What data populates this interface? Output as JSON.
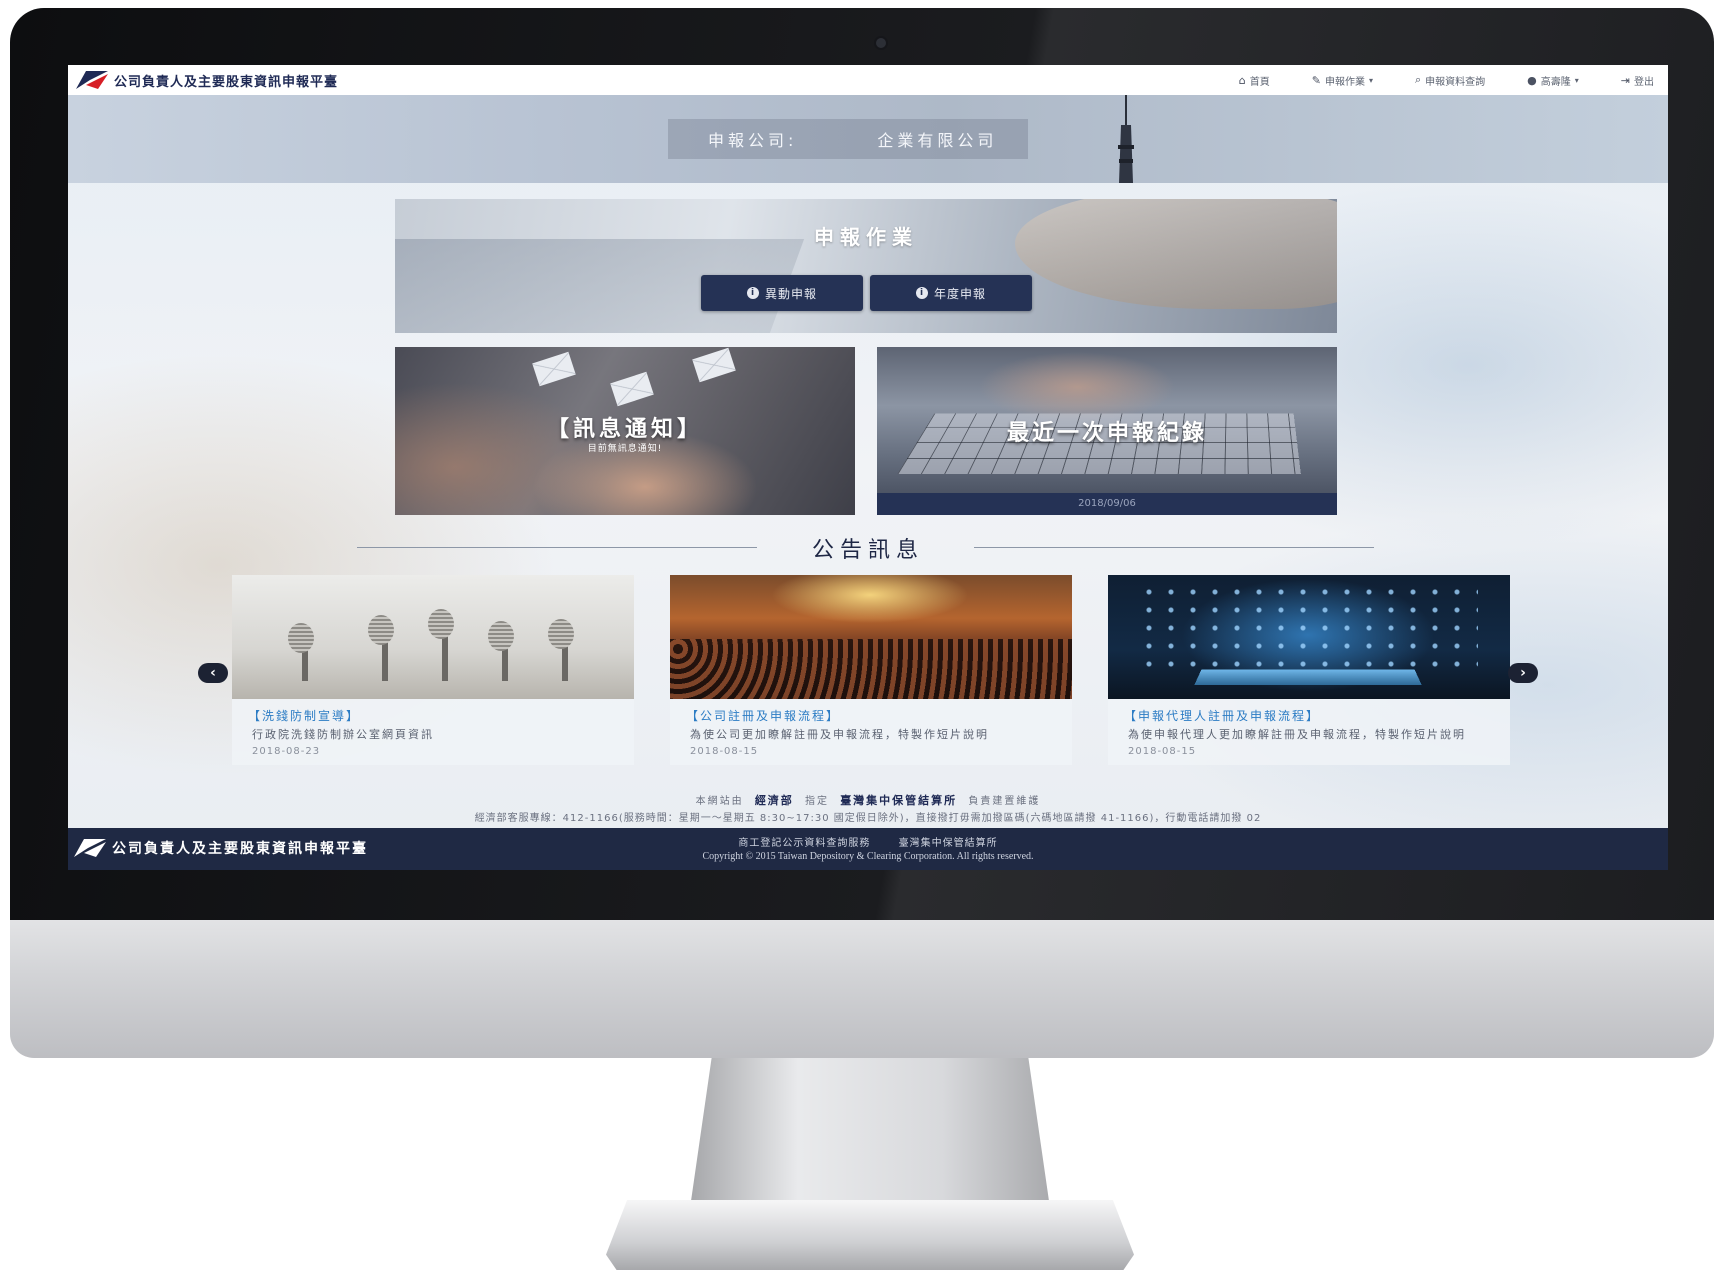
{
  "app": {
    "title": "公司負責人及主要股東資訊申報平臺"
  },
  "nav": {
    "home": "首頁",
    "report": "申報作業",
    "query": "申報資料查詢",
    "user": "高壽隆",
    "logout": "登出"
  },
  "banner": {
    "label": "申報公司:",
    "company": "企業有限公司"
  },
  "report_panel": {
    "title": "申報作業",
    "btn_change": "異動申報",
    "btn_annual": "年度申報"
  },
  "message_tile": {
    "title": "【訊息通知】",
    "subtitle": "目前無訊息通知!"
  },
  "record_tile": {
    "title": "最近一次申報紀錄",
    "date": "2018/09/06"
  },
  "announcements": {
    "heading": "公告訊息",
    "items": [
      {
        "title": "【洗錢防制宣導】",
        "desc": "行政院洗錢防制辦公室網頁資訊",
        "date": "2018-08-23"
      },
      {
        "title": "【公司註冊及申報流程】",
        "desc": "為使公司更加瞭解註冊及申報流程，特製作短片說明",
        "date": "2018-08-15"
      },
      {
        "title": "【申報代理人註冊及申報流程】",
        "desc": "為使申報代理人更加瞭解註冊及申報流程，特製作短片說明",
        "date": "2018-08-15"
      }
    ]
  },
  "credits": {
    "prefix": "本網站由",
    "ministry": "經濟部",
    "designated": "指定",
    "tdcc": "臺灣集中保管結算所",
    "suffix": "負責建置維護",
    "hotline": "經濟部客服專線：412-1166(服務時間：星期一～星期五 8:30~17:30 國定假日除外)，直接撥打毋需加撥區碼(六碼地區請撥 41-1166)，行動電話請加撥 02"
  },
  "footer": {
    "title": "公司負責人及主要股東資訊申報平臺",
    "link1": "商工登記公示資料查詢服務",
    "link2": "臺灣集中保管結算所",
    "copyright": "Copyright © 2015 Taiwan Depository & Clearing Corporation. All rights reserved."
  },
  "icons": {
    "home": "home-icon",
    "pencil": "pencil-icon",
    "search": "search-icon",
    "user": "user-icon",
    "logout": "logout-icon",
    "info": "info-icon",
    "prev": "chevron-left-icon",
    "next": "chevron-right-icon"
  },
  "colors": {
    "navy": "#253255",
    "footer": "#1f2944",
    "link": "#2c7cc4"
  }
}
